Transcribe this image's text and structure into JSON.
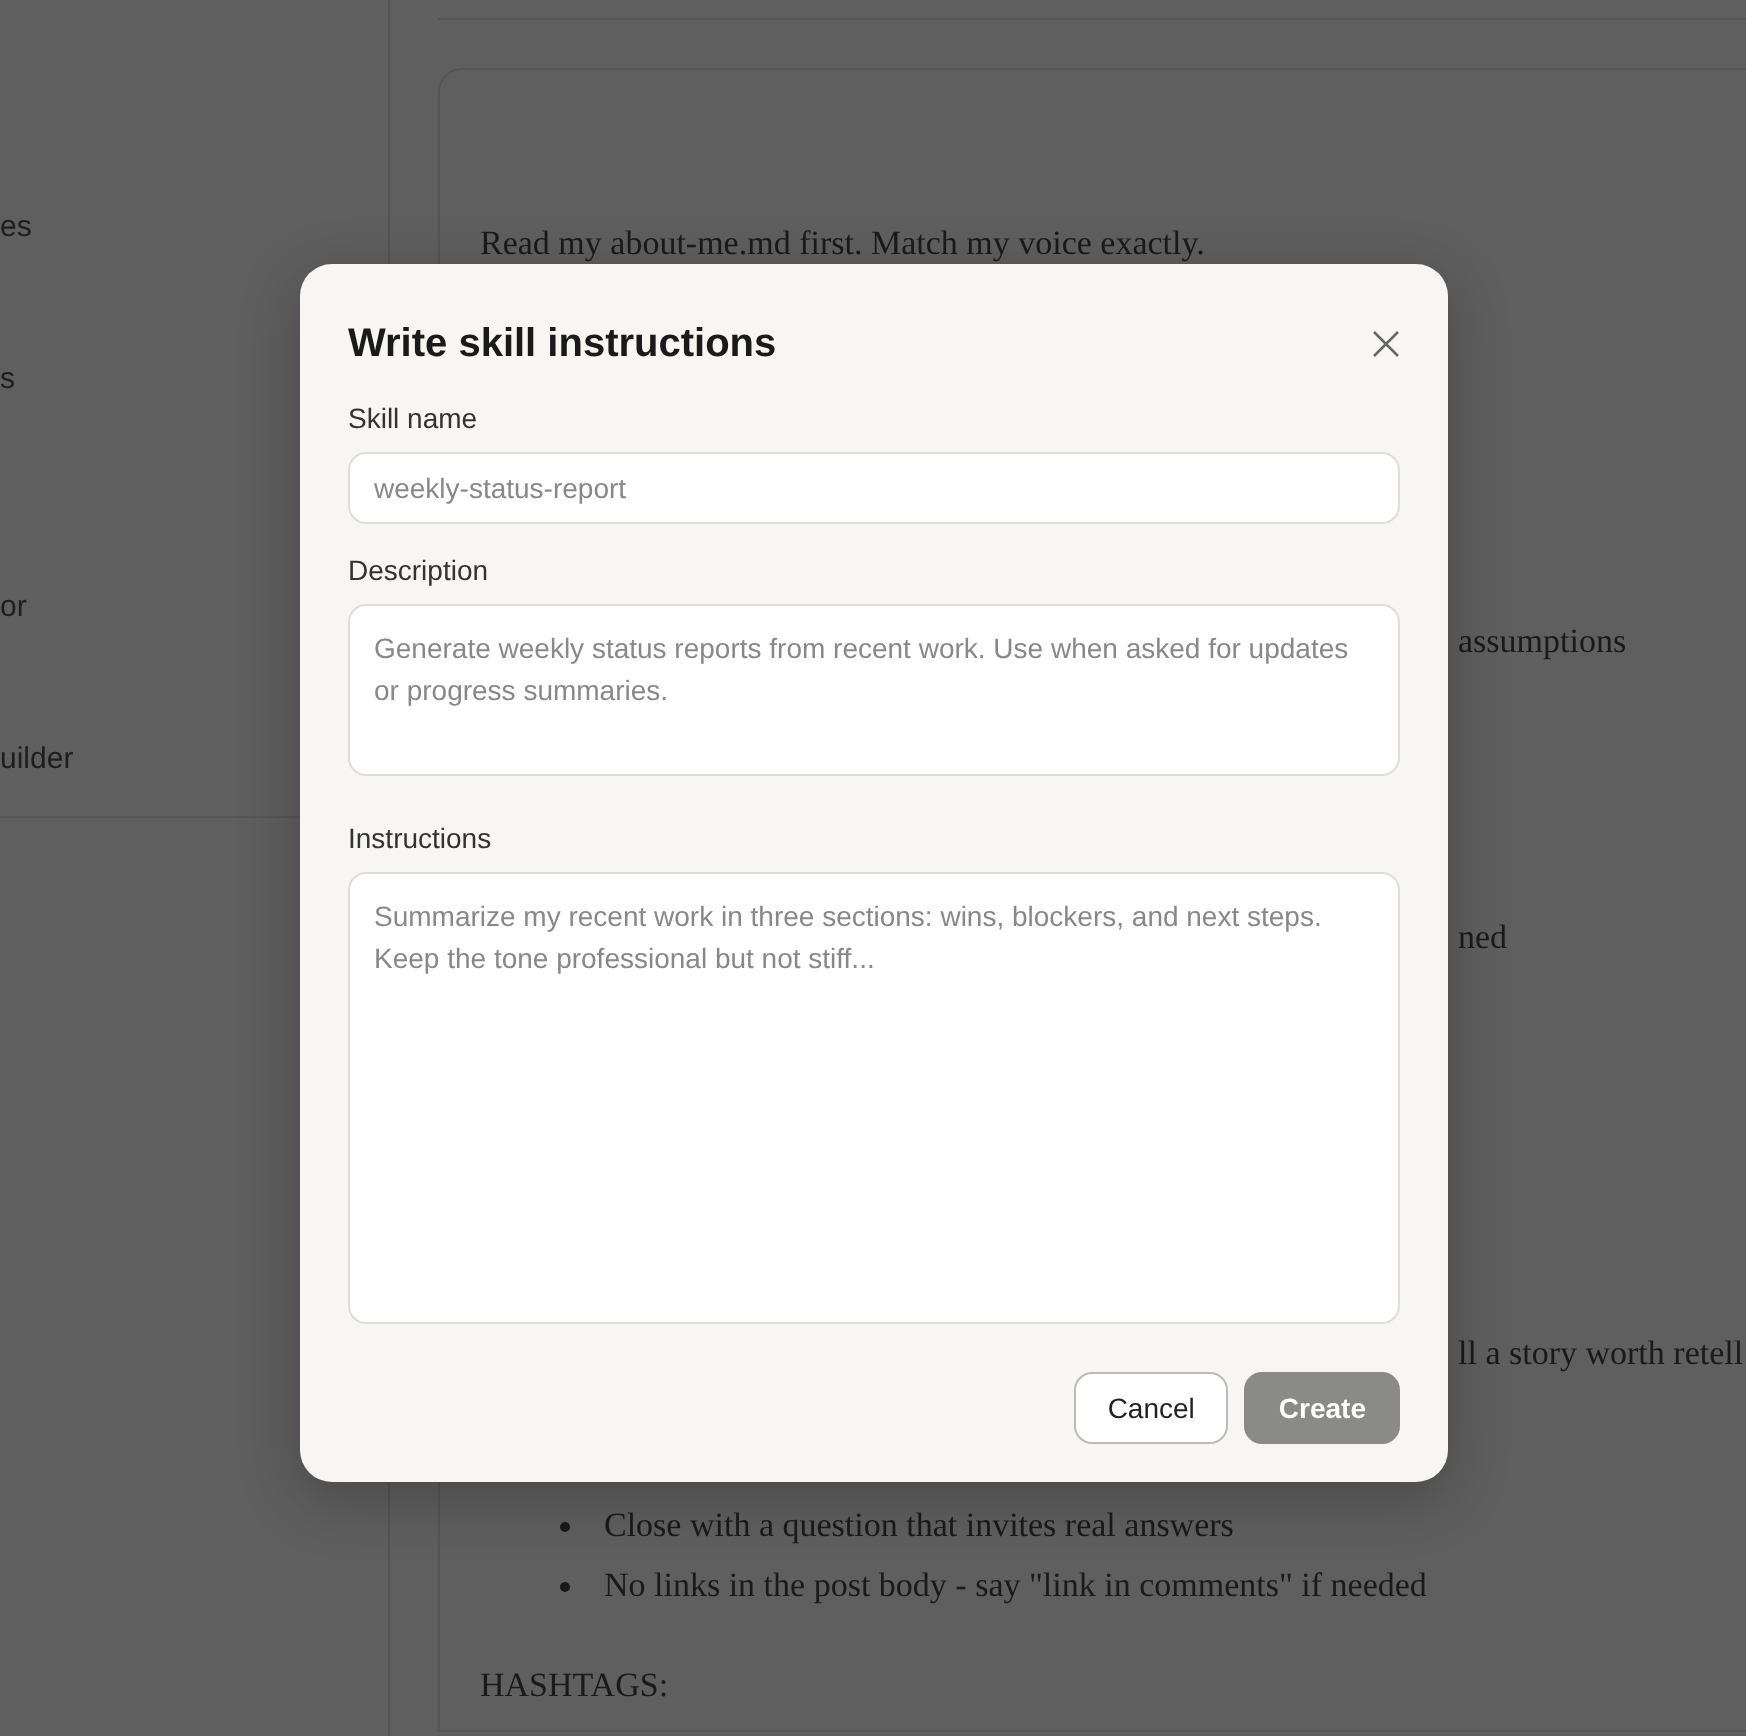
{
  "sidebar": {
    "items": [
      {
        "label": "es"
      },
      {
        "label": "s"
      },
      {
        "label": "or"
      },
      {
        "label": "uilder"
      }
    ]
  },
  "document": {
    "lines": [
      {
        "kind": "text",
        "text": "Read my about-me.md first. Match my voice exactly."
      },
      {
        "kind": "fragment",
        "text": "assumptions"
      },
      {
        "kind": "fragment",
        "text": "ned"
      },
      {
        "kind": "fragment",
        "text": "ll a story worth retell"
      },
      {
        "kind": "bullet",
        "text": "Close with a question that invites real answers"
      },
      {
        "kind": "bullet",
        "text": "No links in the post body - say \"link in comments\" if needed"
      },
      {
        "kind": "text",
        "text": "HASHTAGS:"
      }
    ]
  },
  "dialog": {
    "title": "Write skill instructions",
    "fields": [
      {
        "label": "Skill name",
        "kind": "input",
        "placeholder": "weekly-status-report"
      },
      {
        "label": "Description",
        "kind": "textarea",
        "placeholder": "Generate weekly status reports from recent work. Use when asked for updates or progress summaries."
      },
      {
        "label": "Instructions",
        "kind": "textarea",
        "placeholder": "Summarize my recent work in three sections: wins, blockers, and next steps. Keep the tone professional but not stiff..."
      }
    ],
    "buttons": [
      {
        "label": "Cancel",
        "kind": "secondary",
        "disabled": false
      },
      {
        "label": "Create",
        "kind": "primary",
        "disabled": true
      }
    ]
  }
}
